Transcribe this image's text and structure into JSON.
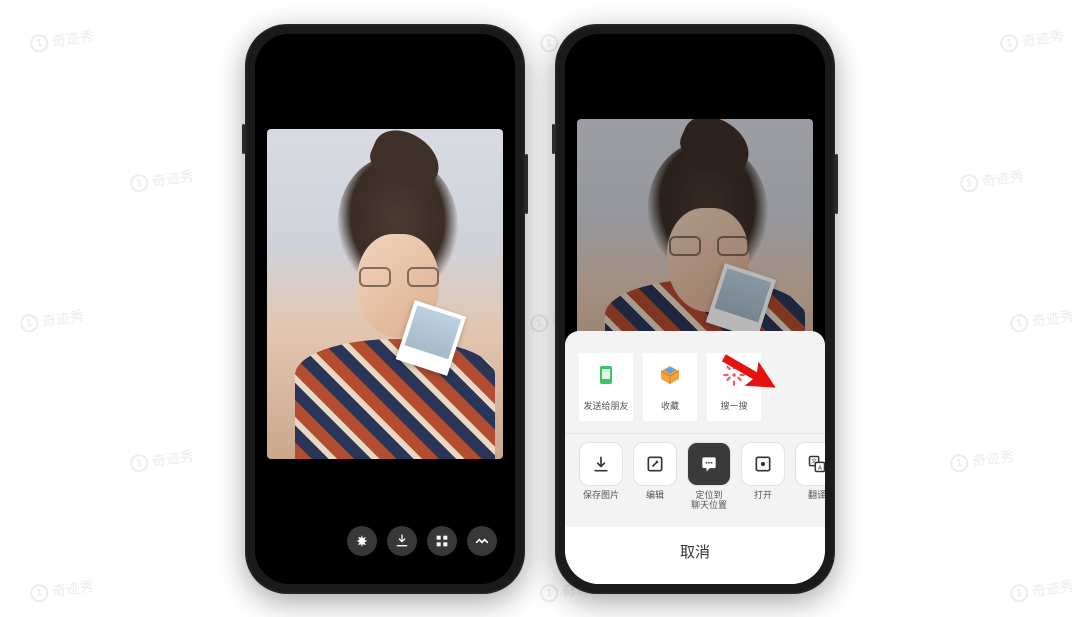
{
  "watermark_text": "奇迹秀",
  "left_phone": {
    "toolbar_icons": [
      "spark-icon",
      "download-icon",
      "grid-icon",
      "more-icon"
    ]
  },
  "right_phone": {
    "share_row": [
      {
        "label": "发送给朋友",
        "icon": "send-friend-icon",
        "color": "#3cc267"
      },
      {
        "label": "收藏",
        "icon": "favorite-icon",
        "color": "#f0a63a"
      },
      {
        "label": "搜一搜",
        "icon": "search-spark-icon",
        "color": "#ef5b5b"
      }
    ],
    "action_row": [
      {
        "label": "保存图片",
        "icon": "save-icon"
      },
      {
        "label": "编辑",
        "icon": "edit-icon"
      },
      {
        "label": "定位到\n聊天位置",
        "icon": "locate-icon",
        "dark": true
      },
      {
        "label": "打开",
        "icon": "open-icon"
      },
      {
        "label": "翻译",
        "icon": "translate-icon"
      }
    ],
    "cancel_label": "取消"
  }
}
